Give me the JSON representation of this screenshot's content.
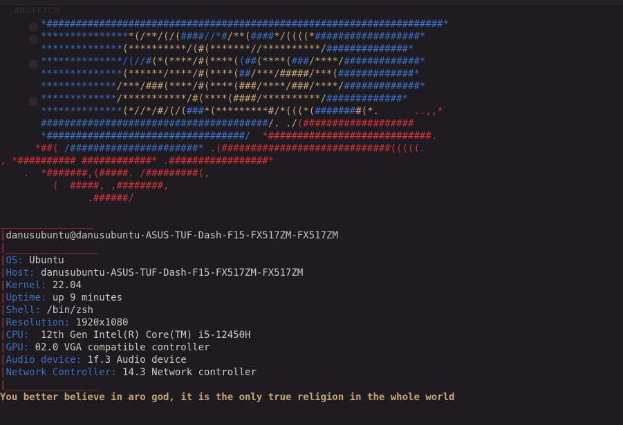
{
  "window": {
    "faint_title": "ARGFETCH"
  },
  "logo_lines": [
    {
      "indent": "       ",
      "segments": [
        {
          "cls": "blue",
          "text": "*####################################################################*"
        }
      ]
    },
    {
      "indent": "       ",
      "segments": [
        {
          "cls": "blue",
          "text": "***************"
        },
        {
          "cls": "orange",
          "text": "*(/**/(/("
        },
        {
          "cls": "blue",
          "text": "####//*#"
        },
        {
          "cls": "orange",
          "text": "/**("
        },
        {
          "cls": "blue",
          "text": "####"
        },
        {
          "cls": "orange",
          "text": "*/((((*"
        },
        {
          "cls": "blue",
          "text": "##################*"
        }
      ]
    },
    {
      "indent": "       ",
      "segments": [
        {
          "cls": "blue",
          "text": "**************"
        },
        {
          "cls": "orange",
          "text": "(**********/(#(*******//**********/"
        },
        {
          "cls": "blue",
          "text": "##############*"
        }
      ]
    },
    {
      "indent": "       ",
      "segments": [
        {
          "cls": "blue",
          "text": "**************/(//#"
        },
        {
          "cls": "orange",
          "text": "(*(****/#(****("
        },
        {
          "cls": "blue",
          "text": "(##"
        },
        {
          "cls": "orange",
          "text": "(****("
        },
        {
          "cls": "blue",
          "text": "###"
        },
        {
          "cls": "orange",
          "text": "/****/"
        },
        {
          "cls": "blue",
          "text": "#############*"
        }
      ]
    },
    {
      "indent": "       ",
      "segments": [
        {
          "cls": "blue",
          "text": "**************"
        },
        {
          "cls": "orange",
          "text": "(******/****/#(****("
        },
        {
          "cls": "blue",
          "text": "##"
        },
        {
          "cls": "orange",
          "text": "/***/#####/***("
        },
        {
          "cls": "blue",
          "text": "#############*"
        }
      ]
    },
    {
      "indent": "       ",
      "segments": [
        {
          "cls": "blue",
          "text": "*************"
        },
        {
          "cls": "orange",
          "text": "/***/###(****/#(****(###/****/###/****/"
        },
        {
          "cls": "blue",
          "text": "#############*"
        }
      ]
    },
    {
      "indent": "       ",
      "segments": [
        {
          "cls": "blue",
          "text": "*************"
        },
        {
          "cls": "orange",
          "text": "/***********/#(****(####/**********/"
        },
        {
          "cls": "blue",
          "text": "#############*"
        }
      ]
    },
    {
      "indent": "       ",
      "segments": [
        {
          "cls": "blue",
          "text": "**************"
        },
        {
          "cls": "orange",
          "text": "(*//*/#/(/("
        },
        {
          "cls": "blue",
          "text": "###"
        },
        {
          "cls": "orange",
          "text": "*(*********#/*(((*("
        },
        {
          "cls": "blue",
          "text": "#######"
        },
        {
          "cls": "orange",
          "text": "#(*."
        },
        {
          "cls": "blue",
          "text": "      "
        },
        {
          "cls": "red",
          "text": "..,,*"
        }
      ]
    },
    {
      "indent": "       ",
      "segments": [
        {
          "cls": "blue",
          "text": "#######################################"
        },
        {
          "cls": "orange",
          "text": "/. ./"
        },
        {
          "cls": "red",
          "text": "(###################"
        }
      ]
    },
    {
      "indent": "       ",
      "segments": [
        {
          "cls": "blue",
          "text": "*##################################/"
        },
        {
          "cls": "red",
          "text": "  *############################."
        }
      ]
    },
    {
      "indent": "      ",
      "segments": [
        {
          "cls": "red",
          "text": "*##( "
        },
        {
          "cls": "blue",
          "text": "/######################*"
        },
        {
          "cls": "red",
          "text": " .(#############################(((((."
        }
      ]
    },
    {
      "indent": "",
      "segments": [
        {
          "cls": "red",
          "text": ", *########## ############* .#################*"
        }
      ]
    },
    {
      "indent": "    ",
      "segments": [
        {
          "cls": "red",
          "text": ".  *#######,(#####. /#########(,"
        }
      ]
    },
    {
      "indent": "         ",
      "segments": [
        {
          "cls": "red",
          "text": "(  #####, ,########,"
        }
      ]
    },
    {
      "indent": "               ",
      "segments": [
        {
          "cls": "red",
          "text": ".######/"
        }
      ]
    }
  ],
  "info": {
    "rule": "________________",
    "user_host": "danusubuntu@danusubuntu-ASUS-TUF-Dash-F15-FX517ZM-FX517ZM",
    "sep": "|",
    "rows": [
      {
        "key": "OS:",
        "value": " Ubuntu"
      },
      {
        "key": "Host:",
        "value": " danusubuntu-ASUS-TUF-Dash-F15-FX517ZM-FX517ZM"
      },
      {
        "key": "Kernel:",
        "value": " 22.04"
      },
      {
        "key": "Uptime:",
        "value": " up 9 minutes"
      },
      {
        "key": "Shell:",
        "value": " /bin/zsh"
      },
      {
        "key": "Resolution:",
        "value": " 1920x1080"
      },
      {
        "key": "CPU:",
        "value": "  12th Gen Intel(R) Core(TM) i5-12450H"
      },
      {
        "key": "GPU:",
        "value": " 02.0 VGA compatible controller"
      },
      {
        "key": "Audio device:",
        "value": " 1f.3 Audio device"
      },
      {
        "key": "Network Controller:",
        "value": " 14.3 Network controller"
      }
    ],
    "quote": "You better believe in aro god, it is the only true religion in the whole world"
  }
}
